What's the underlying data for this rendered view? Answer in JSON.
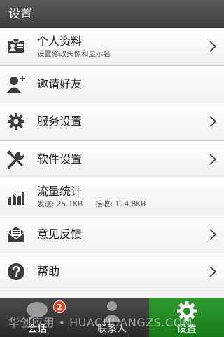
{
  "header": {
    "title": "设置"
  },
  "menu": [
    {
      "label": "个人资料",
      "sub": "设置修改头像和显示名",
      "icon": "id-card-icon",
      "chevron": true
    },
    {
      "label": "邀请好友",
      "icon": "add-user-icon",
      "chevron": false
    },
    {
      "label": "服务设置",
      "icon": "gear-icon",
      "chevron": true
    },
    {
      "label": "软件设置",
      "icon": "wrench-screwdriver-icon",
      "chevron": true
    },
    {
      "label": "流量统计",
      "icon": "bar-chart-icon",
      "chevron": false,
      "stats": {
        "sent": "发送: 25.1KB",
        "received": "接收: 114.8KB"
      }
    },
    {
      "label": "意见反馈",
      "icon": "envelope-icon",
      "chevron": true
    },
    {
      "label": "帮助",
      "icon": "help-icon",
      "chevron": true
    }
  ],
  "tabs": [
    {
      "label": "会话",
      "icon": "chat-bubble-icon",
      "badge": "2",
      "active": false
    },
    {
      "label": "联系人",
      "icon": "person-icon",
      "active": false
    },
    {
      "label": "设置",
      "icon": "gear-icon",
      "active": true
    }
  ],
  "watermark": "华创应用 • HUACHUANGZS.COM",
  "colors": {
    "active_tab": "#1f8a1f",
    "badge": "#e0401a",
    "titlebar": "#4a4a4a"
  }
}
